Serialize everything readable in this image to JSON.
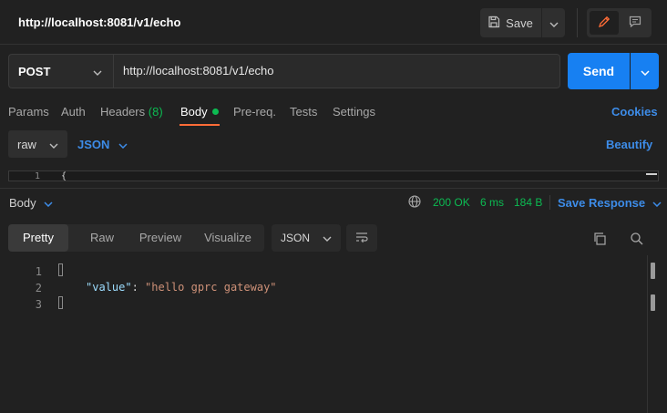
{
  "header": {
    "title": "http://localhost:8081/v1/echo",
    "save_label": "Save",
    "icons": {
      "save": "save-icon",
      "dropdown": "chevron-down-icon",
      "edit": "pencil-icon",
      "comments": "comment-icon"
    }
  },
  "request": {
    "method": "POST",
    "url": "http://localhost:8081/v1/echo",
    "send_label": "Send"
  },
  "tabs": [
    {
      "label": "Params"
    },
    {
      "label": "Auth"
    },
    {
      "label": "Headers",
      "count": "(8)"
    },
    {
      "label": "Body",
      "active": true
    },
    {
      "label": "Pre-req."
    },
    {
      "label": "Tests"
    },
    {
      "label": "Settings"
    }
  ],
  "cookies_label": "Cookies",
  "body_options": {
    "mode": "raw",
    "language": "JSON",
    "beautify_label": "Beautify"
  },
  "request_editor": {
    "line_number": "1",
    "content": "{"
  },
  "response": {
    "label": "Body",
    "status": "200 OK",
    "time": "6 ms",
    "size": "184 B",
    "save_response_label": "Save Response",
    "view_tabs": [
      "Pretty",
      "Raw",
      "Preview",
      "Visualize"
    ],
    "active_view": "Pretty",
    "format": "JSON",
    "lines": [
      "1",
      "2",
      "3"
    ],
    "json_key": "\"value\"",
    "json_value": "\"hello gprc gateway\""
  },
  "colors": {
    "accent": "#1780f2",
    "link": "#3d8ce8",
    "success": "#0cbb52",
    "active_tab_underline": "#ff6c37",
    "edit_icon": "#ff6c37"
  }
}
